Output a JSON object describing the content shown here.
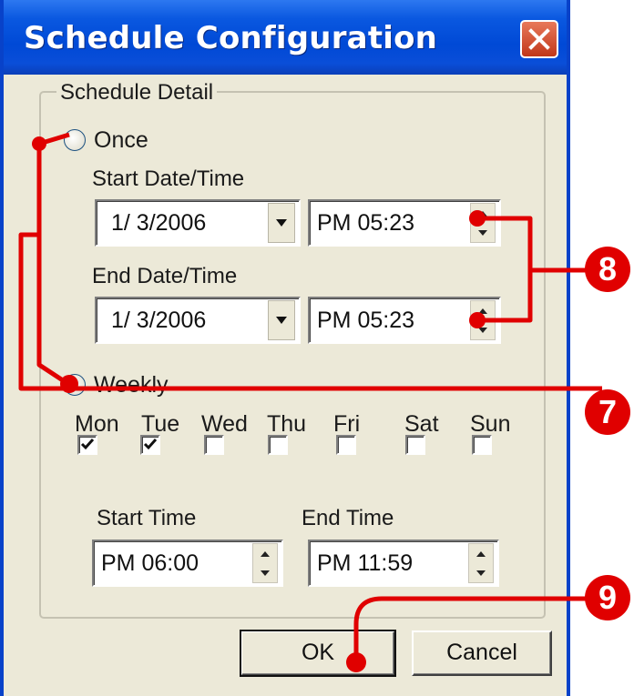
{
  "window": {
    "title": "Schedule Configuration"
  },
  "group": {
    "label": "Schedule Detail"
  },
  "once": {
    "label": "Once",
    "selected": false,
    "start_label": "Start Date/Time",
    "start_date": "1/ 3/2006",
    "start_time": "PM 05:23",
    "end_label": "End Date/Time",
    "end_date": "1/ 3/2006",
    "end_time": "PM 05:23"
  },
  "weekly": {
    "label": "Weekly",
    "selected": true,
    "days": [
      {
        "label": "Mon",
        "checked": true
      },
      {
        "label": "Tue",
        "checked": true
      },
      {
        "label": "Wed",
        "checked": false
      },
      {
        "label": "Thu",
        "checked": false
      },
      {
        "label": "Fri",
        "checked": false
      },
      {
        "label": "Sat",
        "checked": false
      },
      {
        "label": "Sun",
        "checked": false
      }
    ],
    "start_time_label": "Start Time",
    "start_time": "PM 06:00",
    "end_time_label": "End Time",
    "end_time": "PM 11:59"
  },
  "buttons": {
    "ok": "OK",
    "cancel": "Cancel"
  },
  "callouts": {
    "seven": "7",
    "eight": "8",
    "nine": "9"
  },
  "colors": {
    "callout": "#e00000",
    "titlebar": "#0049d6",
    "dialog_bg": "#ece9d8"
  }
}
